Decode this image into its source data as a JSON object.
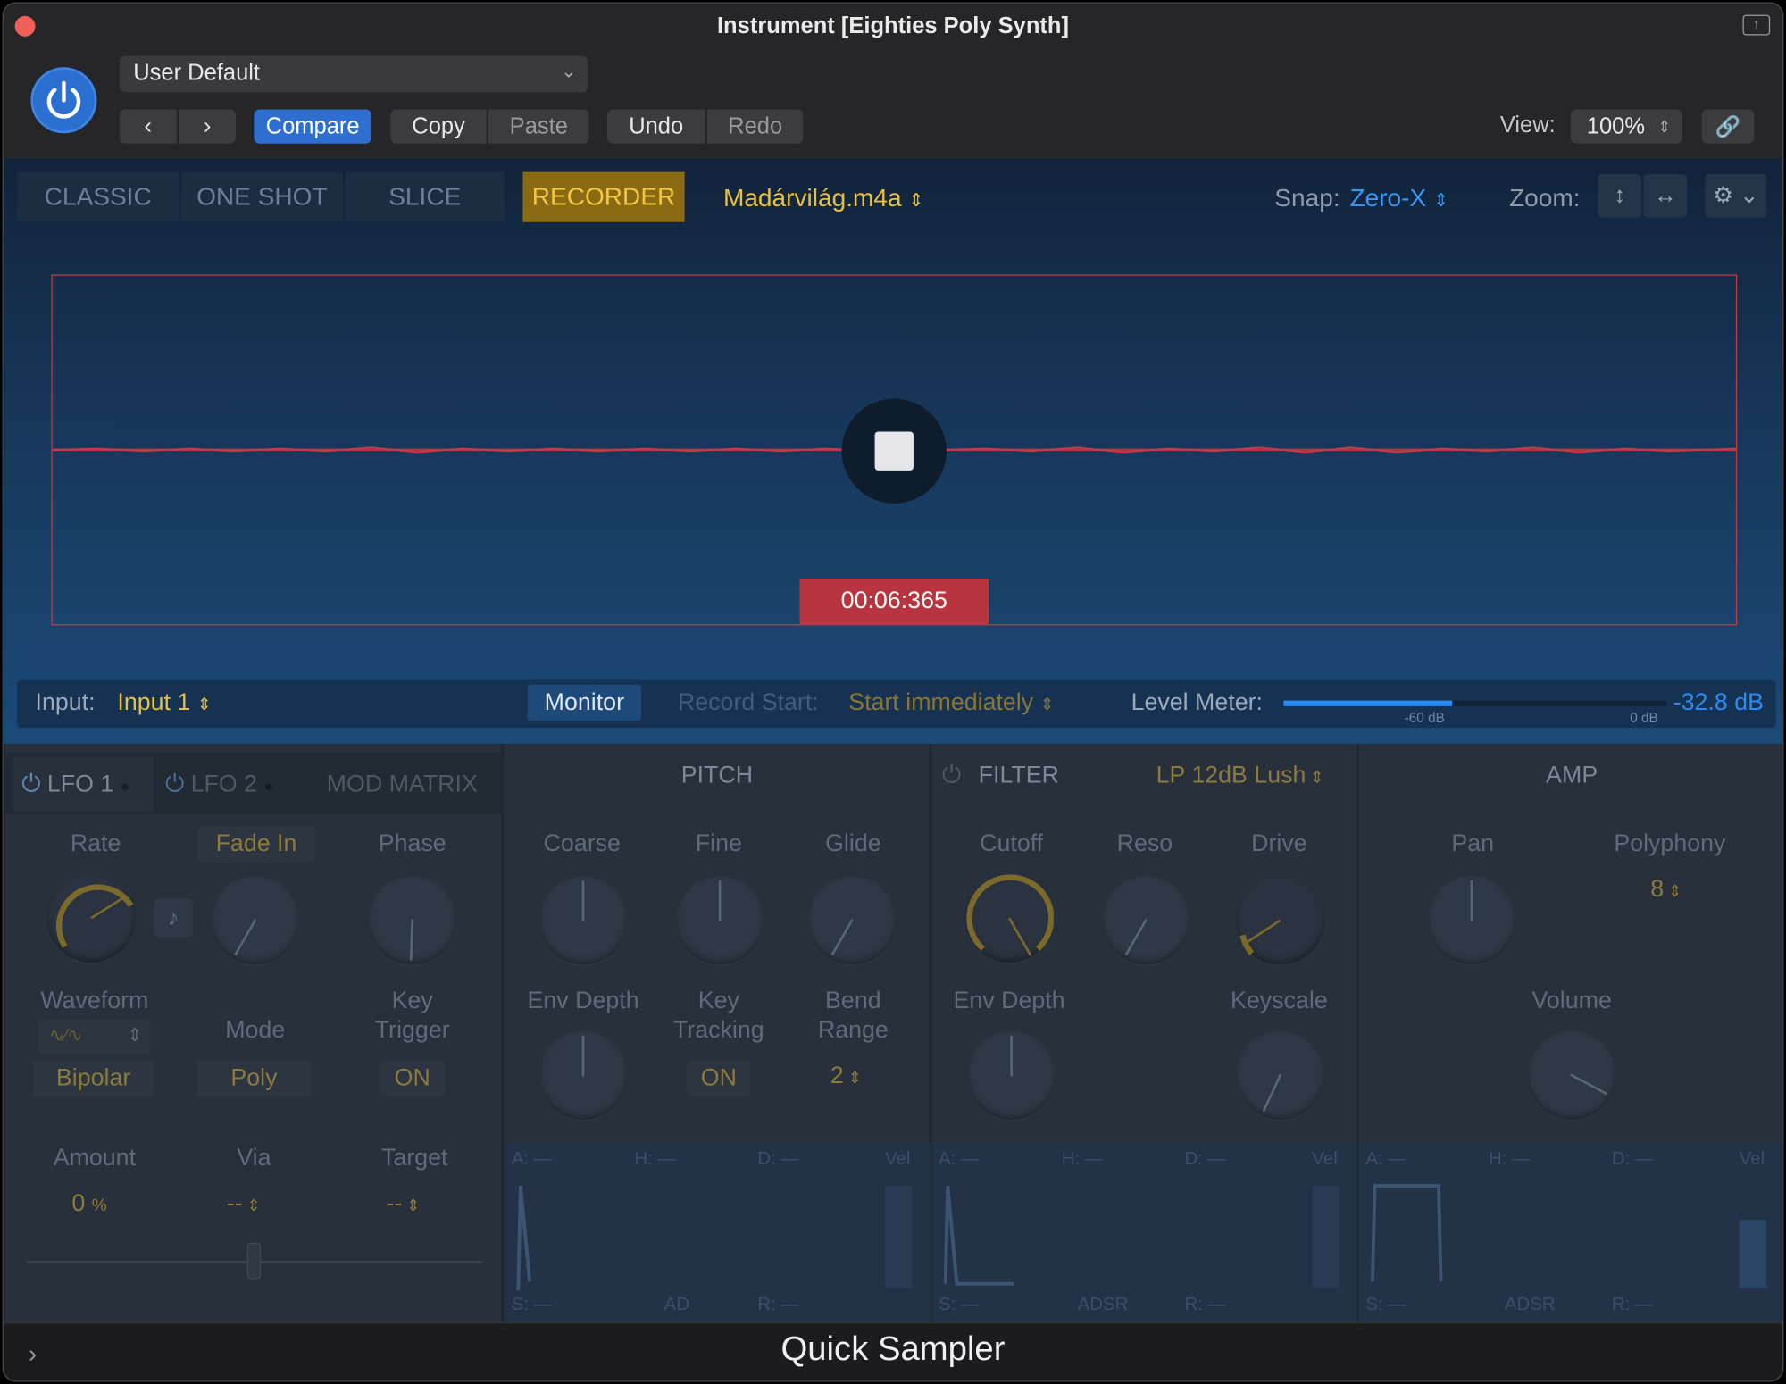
{
  "window": {
    "title": "Instrument [Eighties Poly Synth]",
    "footer_title": "Quick Sampler"
  },
  "header": {
    "preset": "User Default",
    "compare": "Compare",
    "copy": "Copy",
    "paste": "Paste",
    "undo": "Undo",
    "redo": "Redo",
    "view_label": "View:",
    "view_value": "100%"
  },
  "modes": {
    "tabs": [
      "CLASSIC",
      "ONE SHOT",
      "SLICE",
      "RECORDER"
    ],
    "active": "RECORDER",
    "file": "Madárvilág.m4a",
    "snap_label": "Snap:",
    "snap_value": "Zero-X",
    "zoom_label": "Zoom:"
  },
  "recorder": {
    "time": "00:06:365",
    "input_label": "Input:",
    "input_value": "Input 1",
    "monitor": "Monitor",
    "record_start_label": "Record Start:",
    "record_start_value": "Start immediately",
    "level_label": "Level Meter:",
    "level_value": "-32.8 dB",
    "scale_min": "-60 dB",
    "scale_max": "0 dB",
    "level_fraction": 0.44
  },
  "lfo": {
    "tab1": "LFO 1",
    "tab2": "LFO 2",
    "tab3": "MOD MATRIX",
    "rate": "Rate",
    "fade": "Fade In",
    "phase": "Phase",
    "waveform": "Waveform",
    "mode": "Mode",
    "key_trigger_1": "Key",
    "key_trigger_2": "Trigger",
    "bipolar": "Bipolar",
    "poly": "Poly",
    "on": "ON",
    "amount": "Amount",
    "amount_value": "0",
    "amount_unit": "%",
    "via": "Via",
    "via_value": "--",
    "target": "Target",
    "target_value": "--"
  },
  "pitch": {
    "title": "PITCH",
    "coarse": "Coarse",
    "fine": "Fine",
    "glide": "Glide",
    "env_depth": "Env Depth",
    "key_tracking_1": "Key",
    "key_tracking_2": "Tracking",
    "key_tracking_value": "ON",
    "bend_1": "Bend",
    "bend_2": "Range",
    "bend_value": "2"
  },
  "filter": {
    "title": "FILTER",
    "type": "LP 12dB Lush",
    "cutoff": "Cutoff",
    "reso": "Reso",
    "drive": "Drive",
    "env_depth": "Env Depth",
    "keyscale": "Keyscale"
  },
  "amp": {
    "title": "AMP",
    "pan": "Pan",
    "polyphony": "Polyphony",
    "polyphony_value": "8",
    "volume": "Volume"
  },
  "envelopes": {
    "pitch": {
      "a": "A: —",
      "h": "H: —",
      "d": "D: —",
      "vel": "Vel",
      "s": "S: —",
      "mode": "AD",
      "r": "R: —"
    },
    "filter": {
      "a": "A: —",
      "h": "H: —",
      "d": "D: —",
      "vel": "Vel",
      "s": "S: —",
      "mode": "ADSR",
      "r": "R: —"
    },
    "amp": {
      "a": "A: —",
      "h": "H: —",
      "d": "D: —",
      "vel": "Vel",
      "s": "S: —",
      "mode": "ADSR",
      "r": "R: —"
    }
  },
  "colors": {
    "accent_blue": "#3b82e0",
    "accent_yellow": "#e8c040",
    "record_red": "#c23a44"
  }
}
